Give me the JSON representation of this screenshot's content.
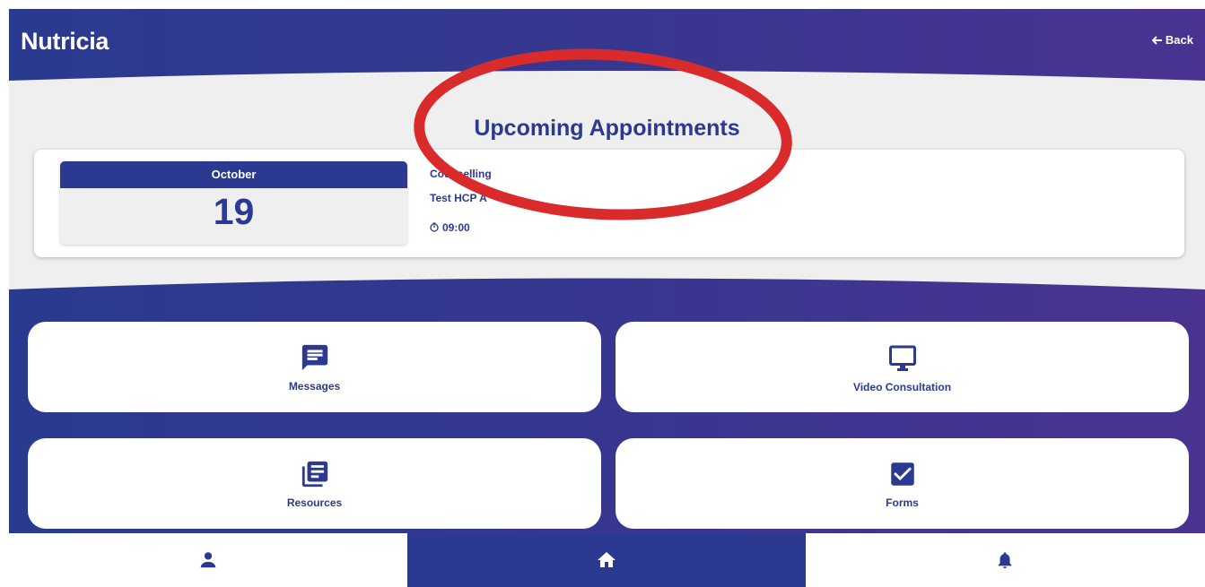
{
  "header": {
    "title": "Nutricia",
    "back_label": "Back"
  },
  "appointments": {
    "title": "Upcoming Appointments",
    "items": [
      {
        "month": "October",
        "day": "19",
        "type": "Counselling",
        "provider": "Test HCP A",
        "time": "09:00"
      }
    ]
  },
  "tiles": [
    {
      "label": "Messages",
      "icon": "message-icon"
    },
    {
      "label": "Video Consultation",
      "icon": "monitor-icon"
    },
    {
      "label": "Resources",
      "icon": "library-books-icon"
    },
    {
      "label": "Forms",
      "icon": "checkbox-icon"
    }
  ],
  "bottom_nav": [
    {
      "icon": "person-icon",
      "active": false
    },
    {
      "icon": "home-icon",
      "active": true
    },
    {
      "icon": "bell-icon",
      "active": false
    }
  ],
  "colors": {
    "primary": "#2b3990",
    "gradient_start": "#2a3a8f",
    "gradient_end": "#4a3390",
    "band": "#efefef",
    "annotation_red": "#d92b2b"
  }
}
